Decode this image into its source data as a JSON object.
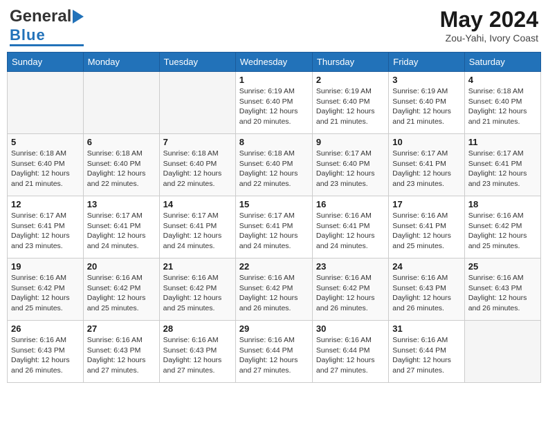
{
  "header": {
    "logo_general": "General",
    "logo_blue": "Blue",
    "month_year": "May 2024",
    "location": "Zou-Yahi, Ivory Coast"
  },
  "calendar": {
    "weekdays": [
      "Sunday",
      "Monday",
      "Tuesday",
      "Wednesday",
      "Thursday",
      "Friday",
      "Saturday"
    ],
    "weeks": [
      [
        {
          "day": "",
          "info": ""
        },
        {
          "day": "",
          "info": ""
        },
        {
          "day": "",
          "info": ""
        },
        {
          "day": "1",
          "info": "Sunrise: 6:19 AM\nSunset: 6:40 PM\nDaylight: 12 hours\nand 20 minutes."
        },
        {
          "day": "2",
          "info": "Sunrise: 6:19 AM\nSunset: 6:40 PM\nDaylight: 12 hours\nand 21 minutes."
        },
        {
          "day": "3",
          "info": "Sunrise: 6:19 AM\nSunset: 6:40 PM\nDaylight: 12 hours\nand 21 minutes."
        },
        {
          "day": "4",
          "info": "Sunrise: 6:18 AM\nSunset: 6:40 PM\nDaylight: 12 hours\nand 21 minutes."
        }
      ],
      [
        {
          "day": "5",
          "info": "Sunrise: 6:18 AM\nSunset: 6:40 PM\nDaylight: 12 hours\nand 21 minutes."
        },
        {
          "day": "6",
          "info": "Sunrise: 6:18 AM\nSunset: 6:40 PM\nDaylight: 12 hours\nand 22 minutes."
        },
        {
          "day": "7",
          "info": "Sunrise: 6:18 AM\nSunset: 6:40 PM\nDaylight: 12 hours\nand 22 minutes."
        },
        {
          "day": "8",
          "info": "Sunrise: 6:18 AM\nSunset: 6:40 PM\nDaylight: 12 hours\nand 22 minutes."
        },
        {
          "day": "9",
          "info": "Sunrise: 6:17 AM\nSunset: 6:40 PM\nDaylight: 12 hours\nand 23 minutes."
        },
        {
          "day": "10",
          "info": "Sunrise: 6:17 AM\nSunset: 6:41 PM\nDaylight: 12 hours\nand 23 minutes."
        },
        {
          "day": "11",
          "info": "Sunrise: 6:17 AM\nSunset: 6:41 PM\nDaylight: 12 hours\nand 23 minutes."
        }
      ],
      [
        {
          "day": "12",
          "info": "Sunrise: 6:17 AM\nSunset: 6:41 PM\nDaylight: 12 hours\nand 23 minutes."
        },
        {
          "day": "13",
          "info": "Sunrise: 6:17 AM\nSunset: 6:41 PM\nDaylight: 12 hours\nand 24 minutes."
        },
        {
          "day": "14",
          "info": "Sunrise: 6:17 AM\nSunset: 6:41 PM\nDaylight: 12 hours\nand 24 minutes."
        },
        {
          "day": "15",
          "info": "Sunrise: 6:17 AM\nSunset: 6:41 PM\nDaylight: 12 hours\nand 24 minutes."
        },
        {
          "day": "16",
          "info": "Sunrise: 6:16 AM\nSunset: 6:41 PM\nDaylight: 12 hours\nand 24 minutes."
        },
        {
          "day": "17",
          "info": "Sunrise: 6:16 AM\nSunset: 6:41 PM\nDaylight: 12 hours\nand 25 minutes."
        },
        {
          "day": "18",
          "info": "Sunrise: 6:16 AM\nSunset: 6:42 PM\nDaylight: 12 hours\nand 25 minutes."
        }
      ],
      [
        {
          "day": "19",
          "info": "Sunrise: 6:16 AM\nSunset: 6:42 PM\nDaylight: 12 hours\nand 25 minutes."
        },
        {
          "day": "20",
          "info": "Sunrise: 6:16 AM\nSunset: 6:42 PM\nDaylight: 12 hours\nand 25 minutes."
        },
        {
          "day": "21",
          "info": "Sunrise: 6:16 AM\nSunset: 6:42 PM\nDaylight: 12 hours\nand 25 minutes."
        },
        {
          "day": "22",
          "info": "Sunrise: 6:16 AM\nSunset: 6:42 PM\nDaylight: 12 hours\nand 26 minutes."
        },
        {
          "day": "23",
          "info": "Sunrise: 6:16 AM\nSunset: 6:42 PM\nDaylight: 12 hours\nand 26 minutes."
        },
        {
          "day": "24",
          "info": "Sunrise: 6:16 AM\nSunset: 6:43 PM\nDaylight: 12 hours\nand 26 minutes."
        },
        {
          "day": "25",
          "info": "Sunrise: 6:16 AM\nSunset: 6:43 PM\nDaylight: 12 hours\nand 26 minutes."
        }
      ],
      [
        {
          "day": "26",
          "info": "Sunrise: 6:16 AM\nSunset: 6:43 PM\nDaylight: 12 hours\nand 26 minutes."
        },
        {
          "day": "27",
          "info": "Sunrise: 6:16 AM\nSunset: 6:43 PM\nDaylight: 12 hours\nand 27 minutes."
        },
        {
          "day": "28",
          "info": "Sunrise: 6:16 AM\nSunset: 6:43 PM\nDaylight: 12 hours\nand 27 minutes."
        },
        {
          "day": "29",
          "info": "Sunrise: 6:16 AM\nSunset: 6:44 PM\nDaylight: 12 hours\nand 27 minutes."
        },
        {
          "day": "30",
          "info": "Sunrise: 6:16 AM\nSunset: 6:44 PM\nDaylight: 12 hours\nand 27 minutes."
        },
        {
          "day": "31",
          "info": "Sunrise: 6:16 AM\nSunset: 6:44 PM\nDaylight: 12 hours\nand 27 minutes."
        },
        {
          "day": "",
          "info": ""
        }
      ]
    ]
  }
}
